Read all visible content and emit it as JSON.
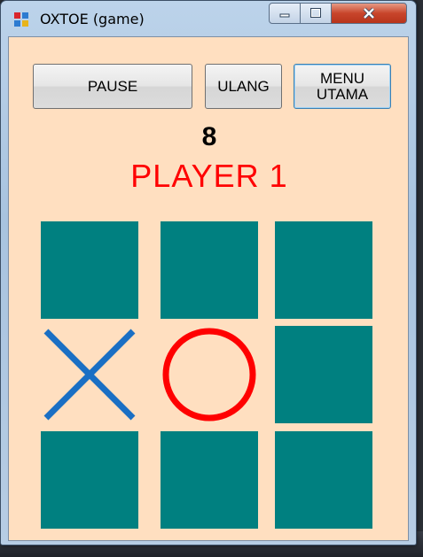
{
  "window": {
    "title": "OXTOE (game)"
  },
  "buttons": {
    "pause": "PAUSE",
    "restart": "ULANG",
    "main_menu": "MENU\nUTAMA"
  },
  "status": {
    "count": "8",
    "player": "PLAYER 1"
  },
  "colors": {
    "cell": "#008080",
    "x_mark": "#1a6fc4",
    "o_mark": "#ff0000",
    "background": "#ffdfc0"
  },
  "board": [
    [
      "",
      "",
      ""
    ],
    [
      "X",
      "O",
      ""
    ],
    [
      "",
      "",
      ""
    ]
  ]
}
